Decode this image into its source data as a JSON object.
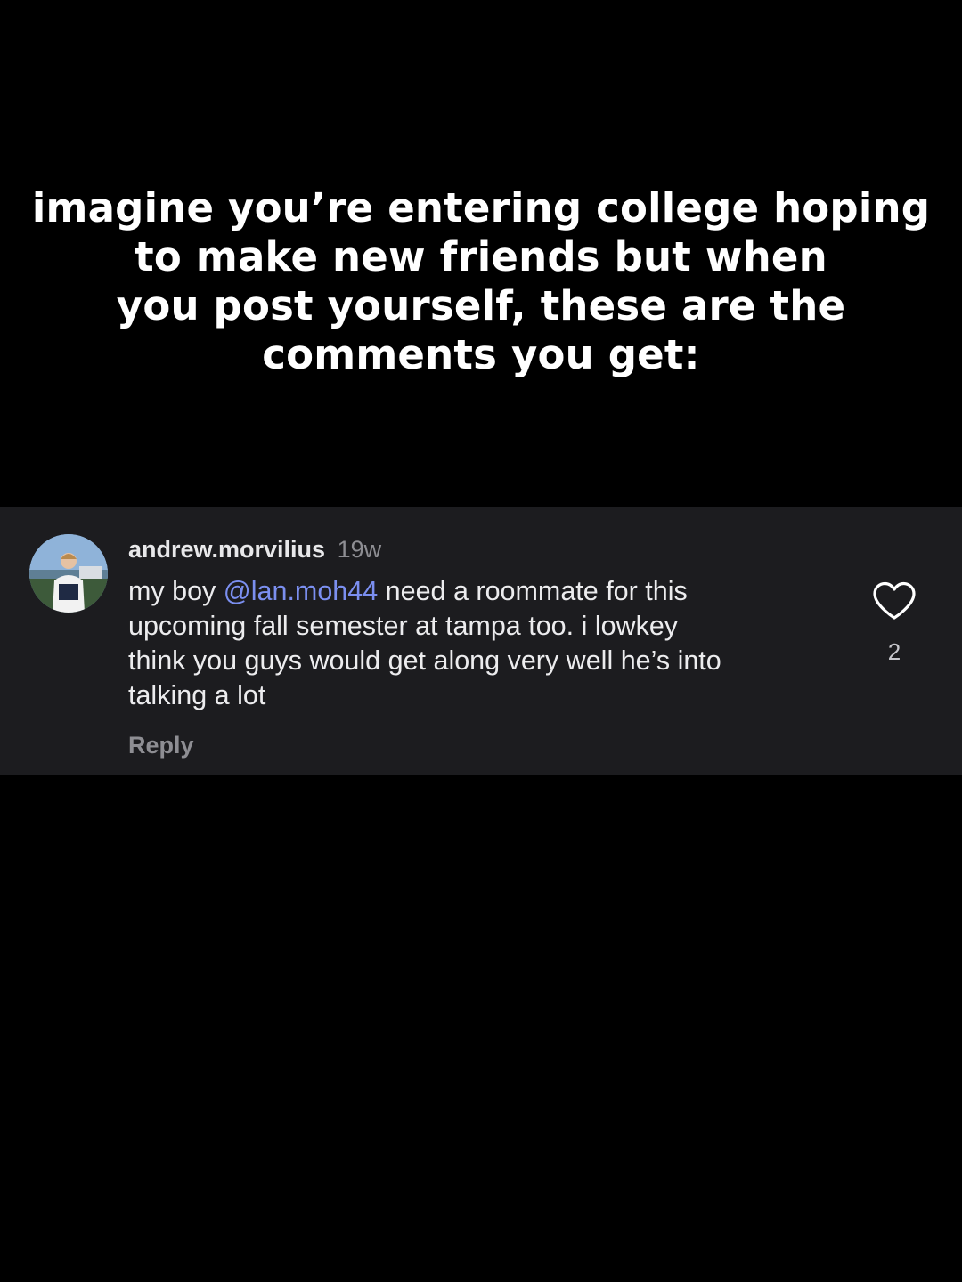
{
  "caption": {
    "lines": [
      "imagine you’re entering college hoping",
      "to make new friends but when",
      "you post yourself, these are the",
      "comments you get:"
    ]
  },
  "comment": {
    "username": "andrew.morvilius",
    "timestamp": "19w",
    "text": {
      "line1_prefix": "my boy ",
      "mention": "@lan.moh44",
      "line1_suffix": " need a roommate for this",
      "line2": "upcoming fall semester at tampa too. i lowkey",
      "line3": "think you guys would get along very well he’s into",
      "line4": "talking a lot"
    },
    "reply_label": "Reply",
    "like_count": "2",
    "like_icon": "heart-outline-icon"
  },
  "colors": {
    "background": "#000000",
    "card_background": "#1c1c1f",
    "mention": "#7b8ff0",
    "secondary_text": "#8e8e93"
  }
}
